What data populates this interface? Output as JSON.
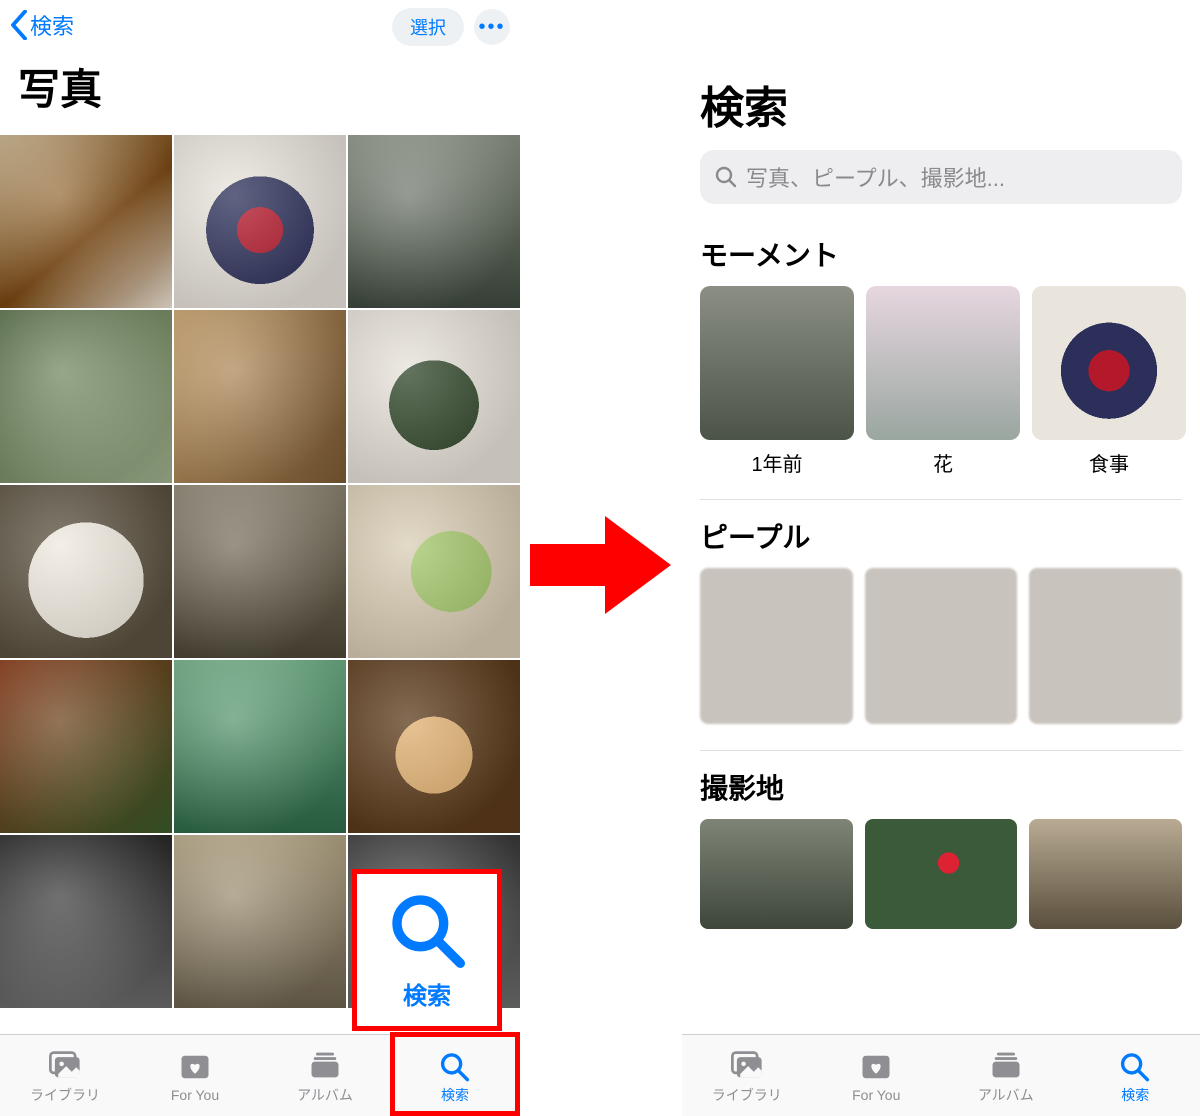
{
  "left": {
    "nav": {
      "back_label": "検索",
      "select_label": "選択"
    },
    "title": "写真",
    "search_callout_label": "検索",
    "tabs": {
      "library": "ライブラリ",
      "for_you": "For You",
      "albums": "アルバム",
      "search": "検索"
    }
  },
  "arrow": {
    "color": "#ff0000"
  },
  "right": {
    "title": "検索",
    "search_placeholder": "写真、ピープル、撮影地...",
    "sections": {
      "moments_header": "モーメント",
      "people_header": "ピープル",
      "places_header": "撮影地"
    },
    "moments": [
      {
        "label": "1年前"
      },
      {
        "label": "花"
      },
      {
        "label": "食事"
      }
    ],
    "tabs": {
      "library": "ライブラリ",
      "for_you": "For You",
      "albums": "アルバム",
      "search": "検索"
    }
  }
}
